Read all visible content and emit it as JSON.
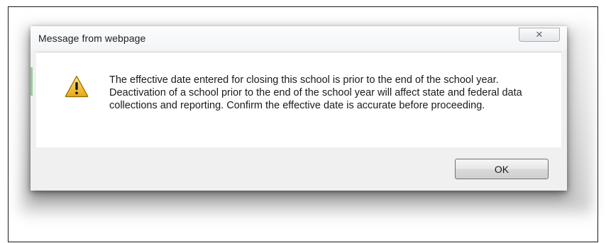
{
  "dialog": {
    "title": "Message from webpage",
    "close_glyph": "✕",
    "icon": "warning-icon",
    "message": "The effective date entered for closing this school is prior to the end of the school year.  Deactivation of a school prior to the end of the school year will affect state and federal data collections and reporting. Confirm the effective date is accurate before proceeding.",
    "ok_label": "OK"
  },
  "colors": {
    "warning_fill": "#f2c12e",
    "warning_outline": "#8a6a00",
    "accent_green": "#6fbf6f"
  }
}
